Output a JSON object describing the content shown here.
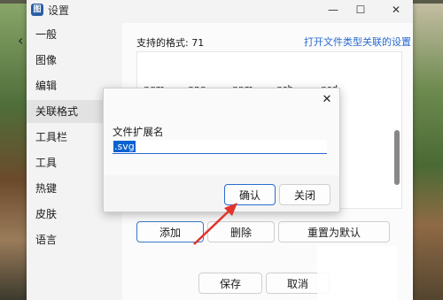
{
  "window": {
    "title": "设置",
    "app_icon_text": "图",
    "minimize_icon": "minimize-icon",
    "maximize_icon": "maximize-icon",
    "close_icon": "close-icon"
  },
  "sidebar": {
    "items": [
      {
        "label": "一般"
      },
      {
        "label": "图像"
      },
      {
        "label": "编辑"
      },
      {
        "label": "关联格式"
      },
      {
        "label": "工具栏"
      },
      {
        "label": "工具"
      },
      {
        "label": "热键"
      },
      {
        "label": "皮肤"
      },
      {
        "label": "语言"
      }
    ],
    "active_index": 3
  },
  "content": {
    "formats_count": "支持的格式: 71",
    "open_link": "打开文件类型关联的设置",
    "format_rows": [
      [
        ".pgm",
        ".png",
        ".ppm",
        ".psb",
        ".psd"
      ]
    ],
    "buttons": {
      "add": "添加",
      "delete": "删除",
      "reset": "重置为默认",
      "save": "保存",
      "cancel": "取消"
    }
  },
  "dialog": {
    "label": "文件扩展名",
    "input_value": ".svg",
    "ok": "确认",
    "close": "关闭",
    "close_icon": "close-icon"
  },
  "colors": {
    "accent": "#2b6bd1",
    "annotation_arrow": "#e0342c"
  }
}
